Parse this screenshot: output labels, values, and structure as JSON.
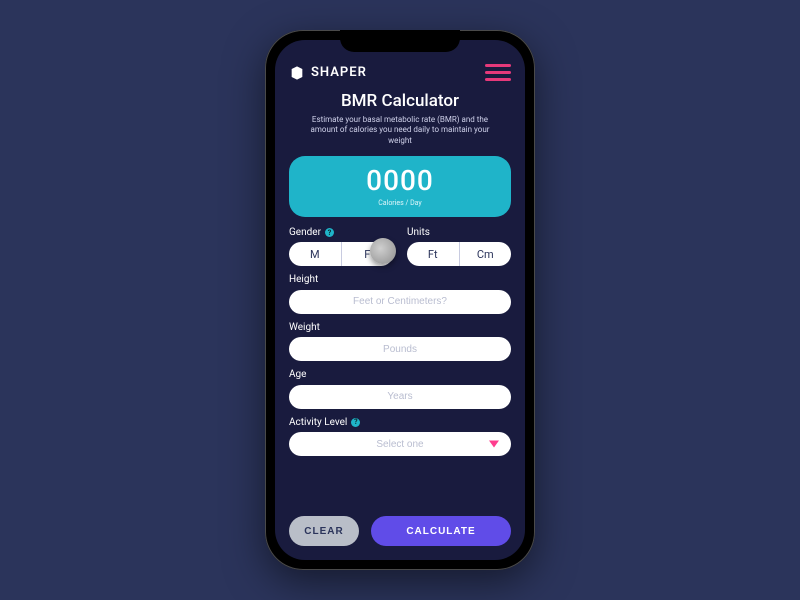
{
  "brand": {
    "name": "SHAPER"
  },
  "title": "BMR Calculator",
  "subtitle": "Estimate your basal metabolic rate (BMR) and the amount of calories you need daily to maintain your weight",
  "result": {
    "value": "0000",
    "unit": "Calories / Day"
  },
  "fields": {
    "gender": {
      "label": "Gender",
      "options": [
        "M",
        "F"
      ],
      "help": "?"
    },
    "units": {
      "label": "Units",
      "options": [
        "Ft",
        "Cm"
      ]
    },
    "height": {
      "label": "Height",
      "placeholder": "Feet or Centimeters?"
    },
    "weight": {
      "label": "Weight",
      "placeholder": "Pounds"
    },
    "age": {
      "label": "Age",
      "placeholder": "Years"
    },
    "activity": {
      "label": "Activity Level",
      "placeholder": "Select one",
      "help": "?"
    }
  },
  "actions": {
    "clear": "CLEAR",
    "calculate": "CALCULATE"
  },
  "colors": {
    "accent_cyan": "#1fb4c9",
    "accent_purple": "#604ce8",
    "accent_pink": "#e6397a",
    "bg_app": "#191b3e",
    "bg_page": "#2b345b"
  }
}
